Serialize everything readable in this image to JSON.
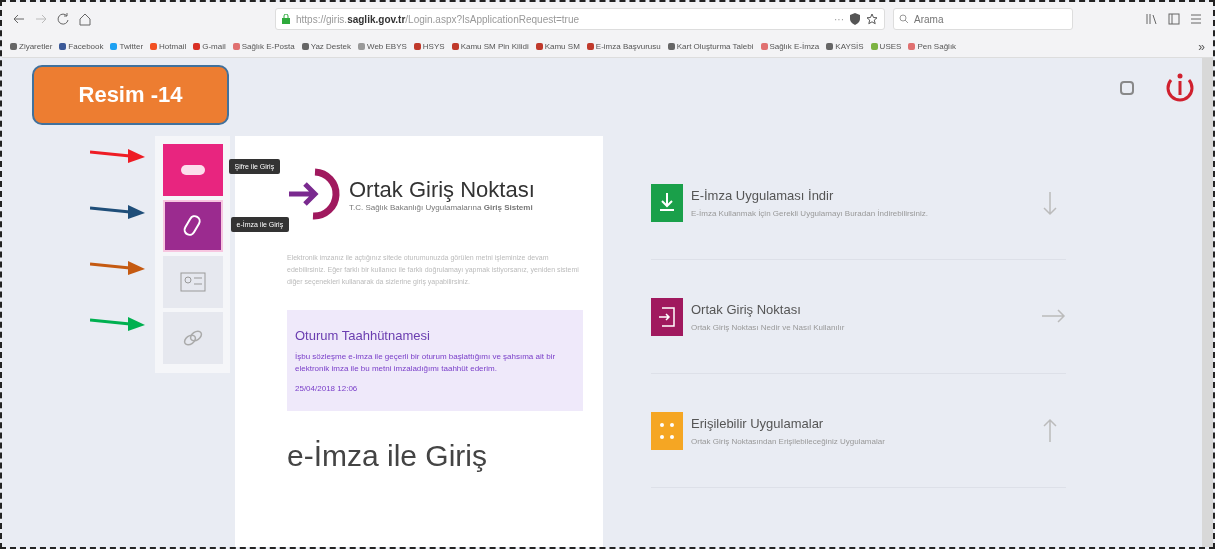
{
  "browser": {
    "url_prefix": "https://giris.",
    "url_domain": "saglik.gov.tr",
    "url_path": "/Login.aspx?IsApplicationRequest=true",
    "more": "···",
    "search": {
      "placeholder": "Arama"
    },
    "bookmarks": [
      {
        "label": "Ziyaretler",
        "color": "#666666"
      },
      {
        "label": "Facebook",
        "color": "#3b5998"
      },
      {
        "label": "Twitter",
        "color": "#1da1f2"
      },
      {
        "label": "Hotmail",
        "color": "#f25022"
      },
      {
        "label": "G-mail",
        "color": "#d93025"
      },
      {
        "label": "Sağlık E-Posta",
        "color": "#e07070"
      },
      {
        "label": "Yaz Destek",
        "color": "#666666"
      },
      {
        "label": "Web EBYS",
        "color": "#999999"
      },
      {
        "label": "HSYS",
        "color": "#c0392b"
      },
      {
        "label": "Kamu SM Pin Kilidi",
        "color": "#c0392b"
      },
      {
        "label": "Kamu SM",
        "color": "#c0392b"
      },
      {
        "label": "E-imza Başvurusu",
        "color": "#c0392b"
      },
      {
        "label": "Kart Oluşturma Talebi",
        "color": "#666666"
      },
      {
        "label": "Sağlık E-İmza",
        "color": "#e07070"
      },
      {
        "label": "KAYSİS",
        "color": "#666666"
      },
      {
        "label": "USES",
        "color": "#7cb342"
      },
      {
        "label": "Pen Sağlık",
        "color": "#e07070"
      }
    ],
    "overflow": "»"
  },
  "annotation": {
    "label": "Resim -14",
    "arrows": [
      {
        "color": "#ee1c24"
      },
      {
        "color": "#1f4e79"
      },
      {
        "color": "#c55a11"
      },
      {
        "color": "#00b050"
      }
    ]
  },
  "sidebar": {
    "items": [
      {
        "kind": "password",
        "color": "#e8257f",
        "tooltip": "Şifre ile Giriş",
        "selected": false
      },
      {
        "kind": "usb",
        "color": "#9b2b8f",
        "tooltip": "e-İmza ile Giriş",
        "selected": true
      },
      {
        "kind": "card",
        "color": "#e6e8ef",
        "selected": false
      },
      {
        "kind": "link",
        "color": "#e6e8ef",
        "selected": false
      }
    ]
  },
  "card": {
    "title": "Ortak Giriş Noktası",
    "subtitle": "T.C. Sağlık Bakanlığı Uygulamalarına **Giriş Sistemi**",
    "intro": "Elektronik imzanız ile açtığınız sitede oturumunuzda görülen metni işleminize devam edebilirsiniz. Eğer farklı bir kullanıcı ile farklı doğrulamayı yapmak istiyorsanız, yeniden sistemi diğer seçenekleri kullanarak da sizlerine giriş yapabilirsiniz.",
    "notice": {
      "title": "Oturum Taahhütnamesi",
      "text": "İşbu sözleşme e-imza ile geçerli bir oturum başlattığımı ve şahsıma ait bir elektronik imza ile bu metni imzaladığımı taahhüt ederim.",
      "date": "25/04/2018 12:06"
    },
    "heading": "e-İmza ile Giriş"
  },
  "links": [
    {
      "kind": "download",
      "color": "#1aa04a",
      "title": "E-İmza Uygulaması İndir",
      "description": "E-İmza Kullanmak İçin Gerekli Uygulamayı Buradan İndirebilirsiniz."
    },
    {
      "kind": "login",
      "color": "#a0195e",
      "title": "Ortak Giriş Noktası",
      "description": "Ortak Giriş Noktası Nedir ve Nasıl Kullanılır"
    },
    {
      "kind": "accessible",
      "color": "#f5a623",
      "title": "Erişilebilir Uygulamalar",
      "description": "Ortak Giriş Noktasından Erişilebileceğiniz Uygulamalar"
    }
  ]
}
